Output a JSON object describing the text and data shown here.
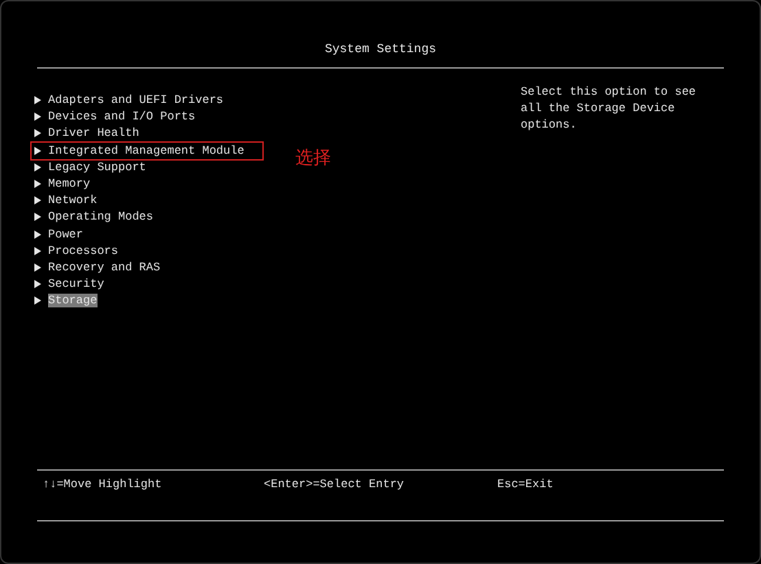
{
  "window": {
    "title": "System Settings"
  },
  "menu": [
    {
      "label": "Adapters and UEFI Drivers",
      "selected": false,
      "annotated": false
    },
    {
      "label": "Devices and I/O Ports",
      "selected": false,
      "annotated": false
    },
    {
      "label": "Driver Health",
      "selected": false,
      "annotated": false
    },
    {
      "label": "Integrated Management Module",
      "selected": false,
      "annotated": true
    },
    {
      "label": "Legacy Support",
      "selected": false,
      "annotated": false
    },
    {
      "label": "Memory",
      "selected": false,
      "annotated": false
    },
    {
      "label": "Network",
      "selected": false,
      "annotated": false
    },
    {
      "label": "Operating Modes",
      "selected": false,
      "annotated": false
    },
    {
      "label": "Power",
      "selected": false,
      "annotated": false
    },
    {
      "label": "Processors",
      "selected": false,
      "annotated": false
    },
    {
      "label": "Recovery and RAS",
      "selected": false,
      "annotated": false
    },
    {
      "label": "Security",
      "selected": false,
      "annotated": false
    },
    {
      "label": "Storage",
      "selected": true,
      "annotated": false
    }
  ],
  "annotation_note": "选择",
  "help_text": "Select this option to see all the Storage Device options.",
  "footer": [
    "↑↓=Move Highlight",
    "<Enter>=Select Entry",
    "Esc=Exit"
  ]
}
